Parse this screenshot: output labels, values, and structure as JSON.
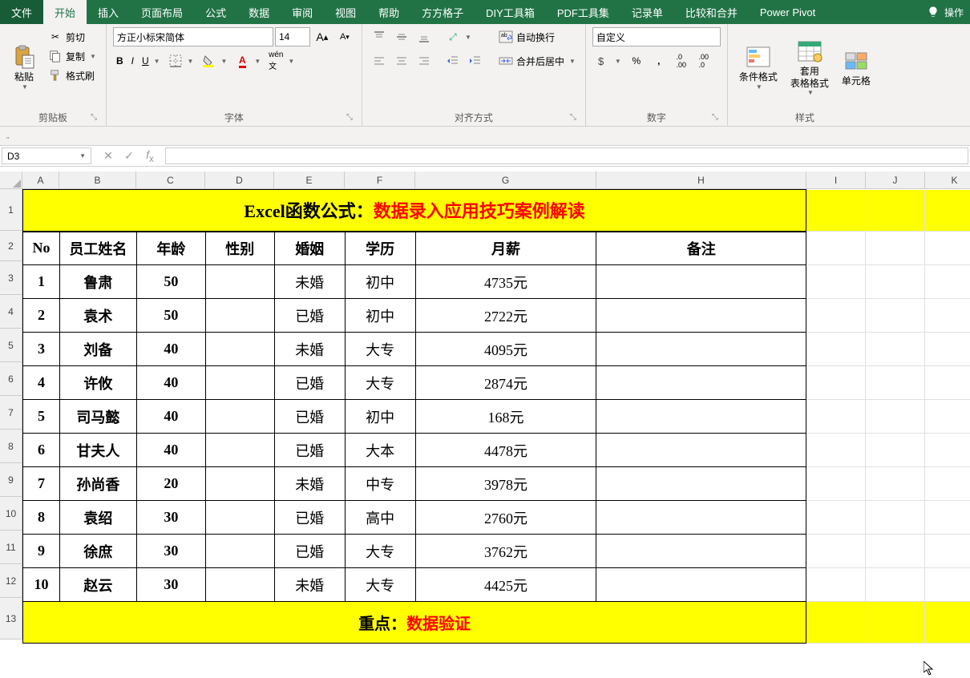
{
  "tabs": {
    "file": "文件",
    "home": "开始",
    "insert": "插入",
    "pagelayout": "页面布局",
    "formulas": "公式",
    "data": "数据",
    "review": "审阅",
    "view": "视图",
    "help": "帮助",
    "ffgz": "方方格子",
    "diy": "DIY工具箱",
    "pdf": "PDF工具集",
    "record": "记录单",
    "compare": "比较和合并",
    "powerpivot": "Power Pivot",
    "tellme": "操作"
  },
  "ribbon": {
    "clipboard": {
      "paste": "粘贴",
      "cut": "剪切",
      "copy": "复制",
      "formatpainter": "格式刷",
      "label": "剪贴板"
    },
    "font": {
      "family": "方正小标宋简体",
      "size": "14",
      "label": "字体"
    },
    "alignment": {
      "wrap": "自动换行",
      "merge": "合并后居中",
      "label": "对齐方式"
    },
    "number": {
      "format": "自定义",
      "label": "数字"
    },
    "styles": {
      "condfmt": "条件格式",
      "tablefmt": "套用\n表格格式",
      "cellfmt": "单元格",
      "label": "样式"
    }
  },
  "namebox": "D3",
  "columns": [
    "A",
    "B",
    "C",
    "D",
    "E",
    "F",
    "G",
    "H",
    "I",
    "J",
    "K"
  ],
  "row_numbers": [
    "1",
    "2",
    "3",
    "4",
    "5",
    "6",
    "7",
    "8",
    "9",
    "10",
    "11",
    "12",
    "13"
  ],
  "title": {
    "prefix": "Excel函数公式：",
    "main": "数据录入应用技巧案例解读"
  },
  "headers": {
    "no": "No",
    "name": "员工姓名",
    "age": "年龄",
    "gender": "性别",
    "marriage": "婚姻",
    "education": "学历",
    "salary": "月薪",
    "remark": "备注"
  },
  "rows": [
    {
      "no": "1",
      "name": "鲁肃",
      "age": "50",
      "gender": "",
      "marriage": "未婚",
      "education": "初中",
      "salary": "4735元",
      "remark": ""
    },
    {
      "no": "2",
      "name": "袁术",
      "age": "50",
      "gender": "",
      "marriage": "已婚",
      "education": "初中",
      "salary": "2722元",
      "remark": ""
    },
    {
      "no": "3",
      "name": "刘备",
      "age": "40",
      "gender": "",
      "marriage": "未婚",
      "education": "大专",
      "salary": "4095元",
      "remark": ""
    },
    {
      "no": "4",
      "name": "许攸",
      "age": "40",
      "gender": "",
      "marriage": "已婚",
      "education": "大专",
      "salary": "2874元",
      "remark": ""
    },
    {
      "no": "5",
      "name": "司马懿",
      "age": "40",
      "gender": "",
      "marriage": "已婚",
      "education": "初中",
      "salary": "168元",
      "remark": ""
    },
    {
      "no": "6",
      "name": "甘夫人",
      "age": "40",
      "gender": "",
      "marriage": "已婚",
      "education": "大本",
      "salary": "4478元",
      "remark": ""
    },
    {
      "no": "7",
      "name": "孙尚香",
      "age": "20",
      "gender": "",
      "marriage": "未婚",
      "education": "中专",
      "salary": "3978元",
      "remark": ""
    },
    {
      "no": "8",
      "name": "袁绍",
      "age": "30",
      "gender": "",
      "marriage": "已婚",
      "education": "高中",
      "salary": "2760元",
      "remark": ""
    },
    {
      "no": "9",
      "name": "徐庶",
      "age": "30",
      "gender": "",
      "marriage": "已婚",
      "education": "大专",
      "salary": "3762元",
      "remark": ""
    },
    {
      "no": "10",
      "name": "赵云",
      "age": "30",
      "gender": "",
      "marriage": "未婚",
      "education": "大专",
      "salary": "4425元",
      "remark": ""
    }
  ],
  "footer": {
    "prefix": "重点：",
    "main": "数据验证"
  }
}
